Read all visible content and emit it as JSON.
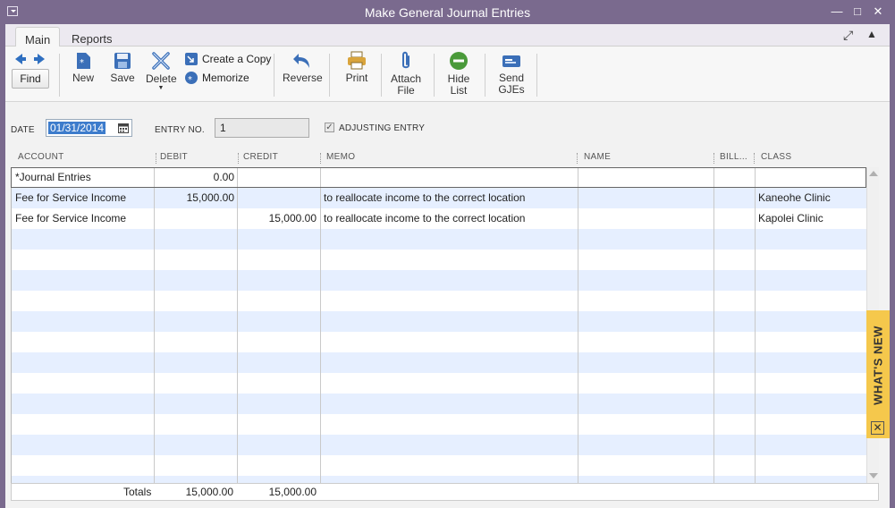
{
  "window": {
    "title": "Make General Journal Entries"
  },
  "tabs": [
    {
      "label": "Main"
    },
    {
      "label": "Reports"
    }
  ],
  "toolbar": {
    "find": "Find",
    "new": "New",
    "save": "Save",
    "delete": "Delete",
    "create_copy": "Create a Copy",
    "memorize": "Memorize",
    "reverse": "Reverse",
    "print": "Print",
    "attach_line1": "Attach",
    "attach_line2": "File",
    "hide_line1": "Hide",
    "hide_line2": "List",
    "send_line1": "Send",
    "send_line2": "GJEs"
  },
  "form": {
    "date_label": "DATE",
    "date_value": "01/31/2014",
    "entry_label": "ENTRY NO.",
    "entry_value": "1",
    "adjusting_label": "ADJUSTING ENTRY",
    "adjusting_checked": true
  },
  "grid": {
    "columns": [
      "ACCOUNT",
      "DEBIT",
      "CREDIT",
      "MEMO",
      "NAME",
      "BILL...",
      "CLASS"
    ],
    "rows": [
      {
        "account": "*Journal Entries",
        "debit": "0.00",
        "credit": "",
        "memo": "",
        "name": "",
        "billable": "",
        "class": ""
      },
      {
        "account": "Fee for Service Income",
        "debit": "15,000.00",
        "credit": "",
        "memo": "to reallocate income to the correct location",
        "name": "",
        "billable": "",
        "class": "Kaneohe Clinic"
      },
      {
        "account": "Fee for Service Income",
        "debit": "",
        "credit": "15,000.00",
        "memo": "to reallocate income to the correct location",
        "name": "",
        "billable": "",
        "class": "Kapolei Clinic"
      }
    ]
  },
  "totals": {
    "label": "Totals",
    "debit": "15,000.00",
    "credit": "15,000.00"
  },
  "whats_new": {
    "label": "WHAT'S NEW"
  },
  "colors": {
    "title_bar": "#7a6a8e",
    "row_alt": "#e6efff",
    "whats_new": "#f5c84c",
    "selection": "#3d7ccc"
  }
}
